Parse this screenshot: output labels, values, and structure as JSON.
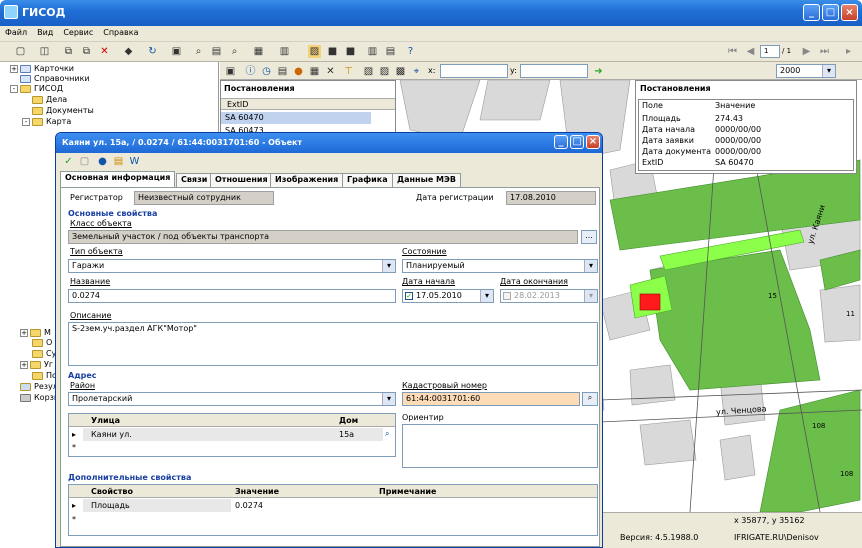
{
  "app": {
    "title": "ГИСОД"
  },
  "menu": [
    "Файл",
    "Вид",
    "Сервис",
    "Справка"
  ],
  "nav": {
    "page_input": "1",
    "page_total": "/ 1"
  },
  "tree": {
    "items": [
      {
        "label": "Карточки",
        "level": 0,
        "expander": "+"
      },
      {
        "label": "Справочники",
        "level": 0,
        "expander": ""
      },
      {
        "label": "ГИСОД",
        "level": 0,
        "expander": "-"
      },
      {
        "label": "Дела",
        "level": 1,
        "expander": ""
      },
      {
        "label": "Документы",
        "level": 1,
        "expander": ""
      },
      {
        "label": "Карта",
        "level": 1,
        "expander": "-"
      }
    ],
    "lower_items": [
      {
        "label": "М",
        "level": 1,
        "expander": "+"
      },
      {
        "label": "О",
        "level": 1,
        "expander": ""
      },
      {
        "label": "Су",
        "level": 1,
        "expander": ""
      },
      {
        "label": "Уг",
        "level": 1,
        "expander": "+"
      },
      {
        "label": "По",
        "level": 1,
        "expander": ""
      },
      {
        "label": "Резул",
        "level": 0,
        "expander": ""
      },
      {
        "label": "Корзи",
        "level": 0,
        "expander": ""
      }
    ]
  },
  "map_toolbar": {
    "x_label": "x:",
    "y_label": "y:",
    "scale": "2000"
  },
  "post_table": {
    "title": "Постановления",
    "column": "ExtID",
    "rows": [
      "SA 60470",
      "SA 60473"
    ]
  },
  "prop_panel": {
    "title": "Постановления",
    "headers": [
      "Поле",
      "Значение"
    ],
    "rows": [
      [
        "Площадь",
        "274.43"
      ],
      [
        "Дата начала",
        "0000/00/00"
      ],
      [
        "Дата заявки",
        "0000/00/00"
      ],
      [
        "Дата документа",
        "0000/00/00"
      ],
      [
        "ExtID",
        "SA 60470"
      ]
    ]
  },
  "map_labels": [
    "ул. Каяни",
    "ул. Ченцова",
    "108",
    "15",
    "108",
    "11"
  ],
  "status": {
    "coords": "x 35877, y 35162",
    "version": "Версия: 4.5.1988.0",
    "user": "IFRIGATE.RU\\Denisov"
  },
  "dialog": {
    "title": "Каяни ул. 15а,  / 0.0274 / 61:44:0031701:60 - Объект",
    "tabs": [
      "Основная информация",
      "Связи",
      "Отношения",
      "Изображения",
      "Графика",
      "Данные МЭВ"
    ],
    "registrar_label": "Регистратор",
    "registrar_value": "Неизвестный сотрудник",
    "regdate_label": "Дата регистрации",
    "regdate_value": "17.08.2010",
    "main_section": "Основные свойства",
    "class_label": "Класс объекта",
    "class_value": "Земельный участок / под объекты транспорта",
    "type_label": "Тип объекта",
    "type_value": "Гаражи",
    "state_label": "Состояние",
    "state_value": "Планируемый",
    "name_label": "Название",
    "name_value": "0.0274",
    "start_label": "Дата начала",
    "start_value": "17.05.2010",
    "end_label": "Дата окончания",
    "end_value": "28.02.2013",
    "desc_label": "Описание",
    "desc_value": "S-2зем.уч.раздел АГК\"Мотор\"",
    "address_section": "Адрес",
    "district_label": "Район",
    "district_value": "Пролетарский",
    "cadastral_label": "Кадастровый номер",
    "cadastral_value": "61:44:0031701:60",
    "street_headers": [
      "Улица",
      "Дом"
    ],
    "street_rows": [
      [
        "Каяни ул.",
        "15а"
      ]
    ],
    "landmark_label": "Ориентир",
    "extra_section": "Дополнительные свойства",
    "extra_headers": [
      "Свойство",
      "Значение",
      "Примечание"
    ],
    "extra_rows": [
      [
        "Площадь",
        "0.0274",
        ""
      ]
    ],
    "ellipsis": "...",
    "star": "*",
    "row_marker": "▸"
  }
}
